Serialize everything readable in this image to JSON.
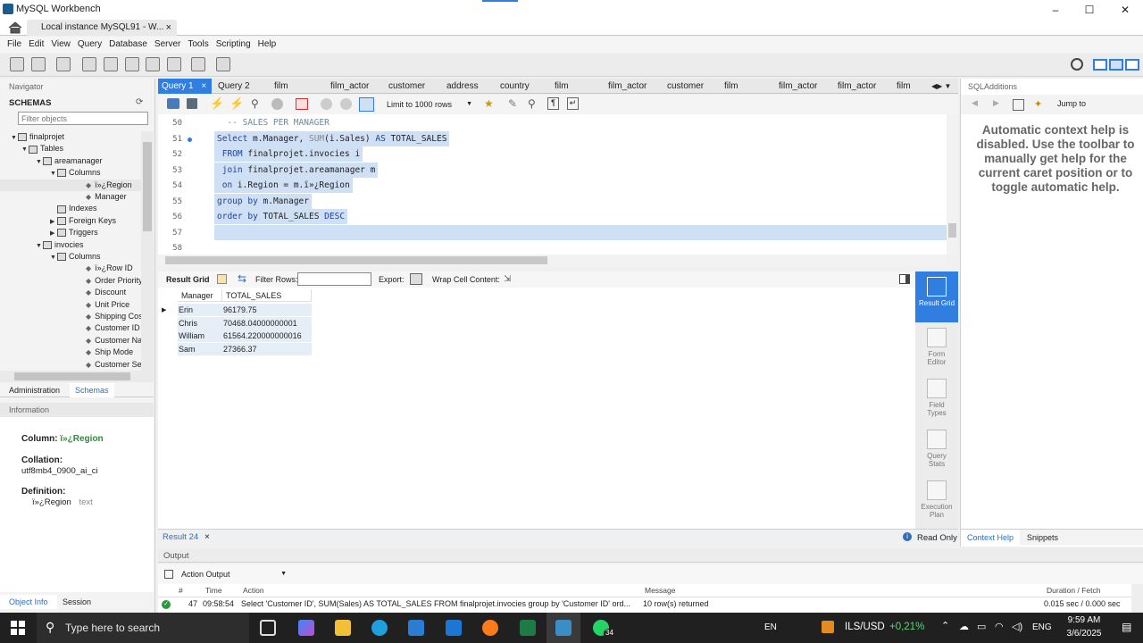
{
  "app_title": "MySQL Workbench",
  "window_controls": {
    "minimize": "–",
    "maximize": "☐",
    "close": "✕"
  },
  "connection_tab": {
    "label": "Local instance MySQL91 - W...",
    "close": "×"
  },
  "menu": [
    "File",
    "Edit",
    "View",
    "Query",
    "Database",
    "Server",
    "Tools",
    "Scripting",
    "Help"
  ],
  "navigator": {
    "header": "Navigator",
    "schemas_label": "SCHEMAS",
    "filter_placeholder": "Filter objects",
    "tree": [
      {
        "label": "finalprojet",
        "level": 0,
        "twisty": "▼",
        "kind": "db"
      },
      {
        "label": "Tables",
        "level": 1,
        "twisty": "▼",
        "kind": "folder"
      },
      {
        "label": "areamanager",
        "level": 2,
        "twisty": "▼",
        "kind": "table"
      },
      {
        "label": "Columns",
        "level": 3,
        "twisty": "▼",
        "kind": "folder"
      },
      {
        "label": "ï»¿Region",
        "level": 4,
        "twisty": "",
        "kind": "col",
        "selected": true
      },
      {
        "label": "Manager",
        "level": 4,
        "twisty": "",
        "kind": "col"
      },
      {
        "label": "Indexes",
        "level": 3,
        "twisty": "",
        "kind": "folder"
      },
      {
        "label": "Foreign Keys",
        "level": 3,
        "twisty": "▶",
        "kind": "folder"
      },
      {
        "label": "Triggers",
        "level": 3,
        "twisty": "▶",
        "kind": "folder"
      },
      {
        "label": "invocies",
        "level": 2,
        "twisty": "▼",
        "kind": "table"
      },
      {
        "label": "Columns",
        "level": 3,
        "twisty": "▼",
        "kind": "folder"
      },
      {
        "label": "ï»¿Row ID",
        "level": 4,
        "twisty": "",
        "kind": "col"
      },
      {
        "label": "Order Priority",
        "level": 4,
        "twisty": "",
        "kind": "col"
      },
      {
        "label": "Discount",
        "level": 4,
        "twisty": "",
        "kind": "col"
      },
      {
        "label": "Unit Price",
        "level": 4,
        "twisty": "",
        "kind": "col"
      },
      {
        "label": "Shipping Cost",
        "level": 4,
        "twisty": "",
        "kind": "col"
      },
      {
        "label": "Customer ID",
        "level": 4,
        "twisty": "",
        "kind": "col"
      },
      {
        "label": "Customer Name",
        "level": 4,
        "twisty": "",
        "kind": "col"
      },
      {
        "label": "Ship Mode",
        "level": 4,
        "twisty": "",
        "kind": "col"
      },
      {
        "label": "Customer Segment",
        "level": 4,
        "twisty": "",
        "kind": "col"
      }
    ],
    "bottom_tabs": [
      "Administration",
      "Schemas"
    ],
    "info_header": "Information",
    "info": {
      "column_label": "Column:",
      "column_value": "ï»¿Region",
      "collation_label": "Collation:",
      "collation_value": "utf8mb4_0900_ai_ci",
      "definition_label": "Definition:",
      "definition_name": "ï»¿Region",
      "definition_type": "text"
    },
    "info_tabs": [
      "Object Info",
      "Session"
    ]
  },
  "query_tabs": [
    "Query 1",
    "Query 2",
    "film",
    "film_actor",
    "customer",
    "address",
    "country",
    "film",
    "film_actor",
    "customer",
    "film",
    "film_actor",
    "film_actor",
    "film"
  ],
  "editor_toolbar": {
    "limit_label": "Limit to 1000 rows"
  },
  "editor": {
    "lines": [
      {
        "no": "50",
        "text": "  -- SALES PER MANAGER",
        "selected": false,
        "dot": false
      },
      {
        "no": "51",
        "text": "Select m.Manager, SUM(i.Sales) AS TOTAL_SALES",
        "selected": true,
        "dot": true
      },
      {
        "no": "52",
        "text": " FROM finalprojet.invocies i",
        "selected": true,
        "dot": false
      },
      {
        "no": "53",
        "text": " join finalprojet.areamanager m",
        "selected": true,
        "dot": false
      },
      {
        "no": "54",
        "text": " on i.Region = m.ï»¿Region",
        "selected": true,
        "dot": false
      },
      {
        "no": "55",
        "text": "group by m.Manager",
        "selected": true,
        "dot": false
      },
      {
        "no": "56",
        "text": "order by TOTAL_SALES DESC",
        "selected": true,
        "dot": false
      },
      {
        "no": "57",
        "text": "",
        "selected": true,
        "dot": false
      },
      {
        "no": "58",
        "text": "",
        "selected": false,
        "dot": false
      }
    ]
  },
  "result_toolbar": {
    "result_grid": "Result Grid",
    "filter_rows": "Filter Rows:",
    "export": "Export:",
    "wrap": "Wrap Cell Content:"
  },
  "result_grid": {
    "columns": [
      "Manager",
      "TOTAL_SALES"
    ],
    "rows": [
      [
        "Erin",
        "96179.75"
      ],
      [
        "Chris",
        "70468.04000000001"
      ],
      [
        "William",
        "61564.220000000016"
      ],
      [
        "Sam",
        "27366.37"
      ]
    ]
  },
  "right_panel": [
    {
      "label": "Result Grid",
      "active": true
    },
    {
      "label": "Form Editor",
      "active": false
    },
    {
      "label": "Field Types",
      "active": false
    },
    {
      "label": "Query Stats",
      "active": false
    },
    {
      "label": "Execution Plan",
      "active": false
    }
  ],
  "result_tabs": {
    "tab": "Result 24",
    "read_only": "Read Only"
  },
  "output": {
    "header": "Output",
    "dropdown": "Action Output",
    "columns": {
      "num": "#",
      "time": "Time",
      "action": "Action",
      "message": "Message",
      "duration": "Duration / Fetch"
    },
    "row": {
      "num": "47",
      "time": "09:58:54",
      "action": "Select 'Customer ID', SUM(Sales) AS TOTAL_SALES   FROM finalprojet.invocies  group by 'Customer ID'  ord...",
      "message": "10 row(s) returned",
      "duration": "0.015 sec / 0.000 sec"
    }
  },
  "sql_additions": {
    "header": "SQLAdditions",
    "jump_to": "Jump to",
    "help_text": "Automatic context help is disabled. Use the toolbar to manually get help for the current caret position or to toggle automatic help.",
    "tabs": [
      "Context Help",
      "Snippets"
    ]
  },
  "taskbar": {
    "search": "Type here to search",
    "lang": "EN",
    "ticker": "ILS/USD",
    "ticker_change": "+0,21%",
    "kbd": "ENG",
    "time": "9:59 AM",
    "date": "3/6/2025",
    "badge": "34"
  },
  "colors": {
    "accent": "#2f7ee0",
    "selection": "#cfe0f5",
    "keyword": "#1f3fa0"
  }
}
